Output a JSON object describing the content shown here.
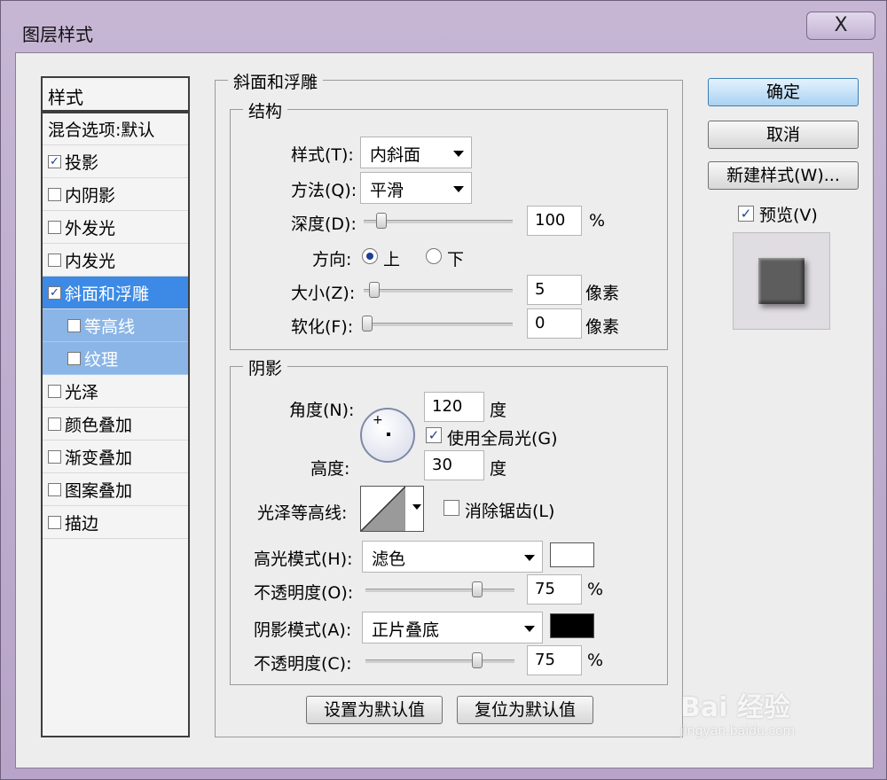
{
  "window": {
    "title": "图层样式",
    "close_label": "X"
  },
  "style_list": {
    "header": "样式",
    "blend_options": "混合选项:默认",
    "items": [
      {
        "label": "投影",
        "checked": true
      },
      {
        "label": "内阴影",
        "checked": false
      },
      {
        "label": "外发光",
        "checked": false
      },
      {
        "label": "内发光",
        "checked": false
      },
      {
        "label": "斜面和浮雕",
        "checked": true
      },
      {
        "label": "等高线",
        "checked": false
      },
      {
        "label": "纹理",
        "checked": false
      },
      {
        "label": "光泽",
        "checked": false
      },
      {
        "label": "颜色叠加",
        "checked": false
      },
      {
        "label": "渐变叠加",
        "checked": false
      },
      {
        "label": "图案叠加",
        "checked": false
      },
      {
        "label": "描边",
        "checked": false
      }
    ]
  },
  "bevel": {
    "title": "斜面和浮雕",
    "structure": {
      "title": "结构",
      "style_label": "样式(T):",
      "style_value": "内斜面",
      "technique_label": "方法(Q):",
      "technique_value": "平滑",
      "depth_label": "深度(D):",
      "depth_value": "100",
      "depth_unit": "%",
      "depth_slider": 0.03,
      "direction_label": "方向:",
      "direction_up": "上",
      "direction_down": "下",
      "size_label": "大小(Z):",
      "size_value": "5",
      "size_unit": "像素",
      "soften_label": "软化(F):",
      "soften_value": "0",
      "soften_unit": "像素"
    },
    "shading": {
      "title": "阴影",
      "angle_label": "角度(N):",
      "angle_value": "120",
      "angle_unit": "度",
      "global_light_label": "使用全局光(G)",
      "altitude_label": "高度:",
      "altitude_value": "30",
      "altitude_unit": "度",
      "gloss_contour_label": "光泽等高线:",
      "anti_aliased_label": "消除锯齿(L)",
      "highlight_mode_label": "高光模式(H):",
      "highlight_mode_value": "滤色",
      "highlight_color": "#ffffff",
      "highlight_opacity_label": "不透明度(O):",
      "highlight_opacity_value": "75",
      "opacity_unit": "%",
      "shadow_mode_label": "阴影模式(A):",
      "shadow_mode_value": "正片叠底",
      "shadow_color": "#000000",
      "shadow_opacity_label": "不透明度(C):",
      "shadow_opacity_value": "75"
    },
    "make_default": "设置为默认值",
    "reset_default": "复位为默认值"
  },
  "buttons": {
    "ok": "确定",
    "cancel": "取消",
    "new_style": "新建样式(W)...",
    "preview_label": "预览(V)"
  },
  "watermark": {
    "text": "Bai 经验",
    "url": "jingyan.baidu.com"
  }
}
